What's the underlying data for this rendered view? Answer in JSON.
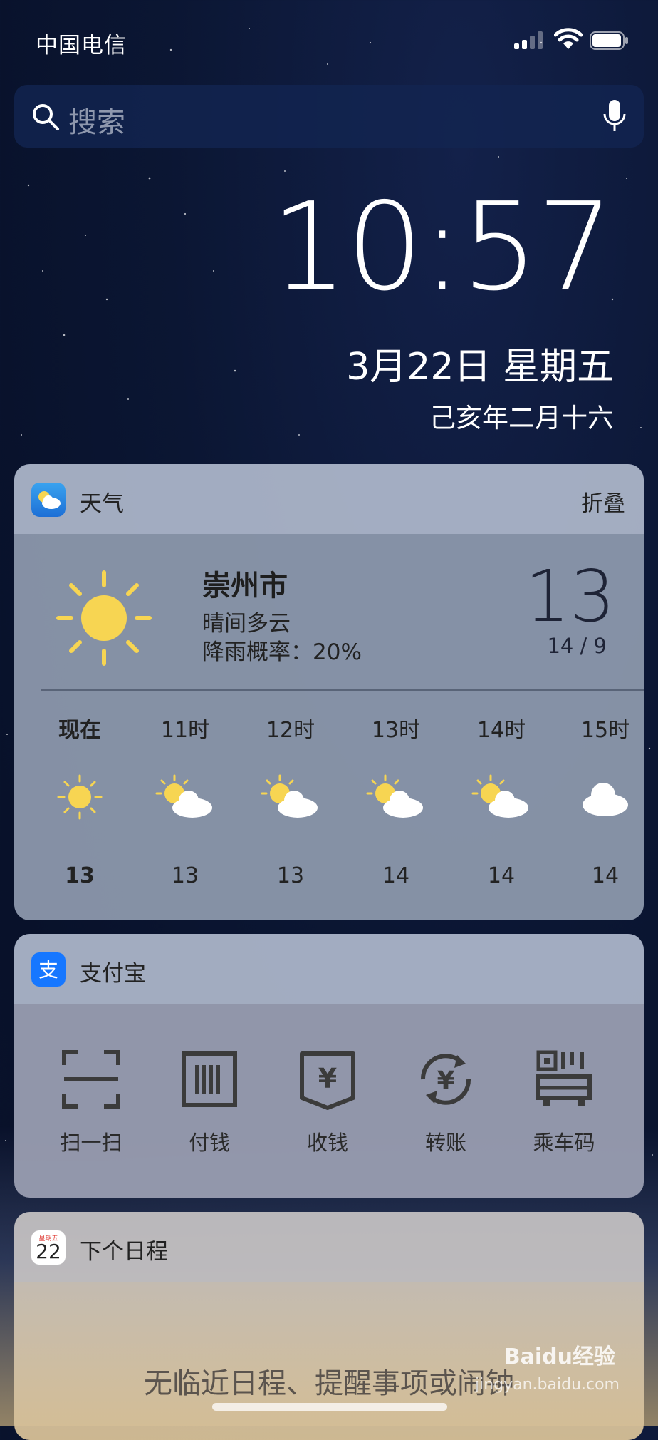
{
  "status_bar": {
    "carrier": "中国电信",
    "signal_bars": 2,
    "battery_level": 0.9
  },
  "search": {
    "placeholder": "搜索",
    "icon": "search-icon",
    "mic_icon": "microphone-icon"
  },
  "lock_screen": {
    "time": "10:57",
    "date": "3月22日 星期五",
    "lunar_date": "己亥年二月十六"
  },
  "weather": {
    "title": "天气",
    "collapse_label": "折叠",
    "city": "崇州市",
    "condition": "晴间多云",
    "rain_chance": "降雨概率：20%",
    "current_temp": "13",
    "range": "14 / 9",
    "hourly": [
      {
        "label": "现在",
        "icon": "sun-icon",
        "temp": "13"
      },
      {
        "label": "11时",
        "icon": "partly-cloudy-icon",
        "temp": "13"
      },
      {
        "label": "12时",
        "icon": "partly-cloudy-icon",
        "temp": "13"
      },
      {
        "label": "13时",
        "icon": "partly-cloudy-icon",
        "temp": "14"
      },
      {
        "label": "14时",
        "icon": "partly-cloudy-icon",
        "temp": "14"
      },
      {
        "label": "15时",
        "icon": "cloud-icon",
        "temp": "14"
      }
    ]
  },
  "alipay": {
    "title": "支付宝",
    "actions": [
      {
        "label": "扫一扫",
        "icon": "scan-icon"
      },
      {
        "label": "付钱",
        "icon": "barcode-icon"
      },
      {
        "label": "收钱",
        "icon": "receive-money-icon"
      },
      {
        "label": "转账",
        "icon": "transfer-icon"
      },
      {
        "label": "乘车码",
        "icon": "bus-code-icon"
      }
    ]
  },
  "schedule": {
    "title": "下个日程",
    "calendar_weekday": "星期五",
    "calendar_day": "22",
    "empty_text": "无临近日程、提醒事项或闹钟"
  },
  "watermark": {
    "brand": "Baidu经验",
    "url": "jingyan.baidu.com"
  },
  "colors": {
    "sun": "#f7d552",
    "weather_panel": "#8c98ac",
    "alipay_blue": "#1677ff"
  }
}
